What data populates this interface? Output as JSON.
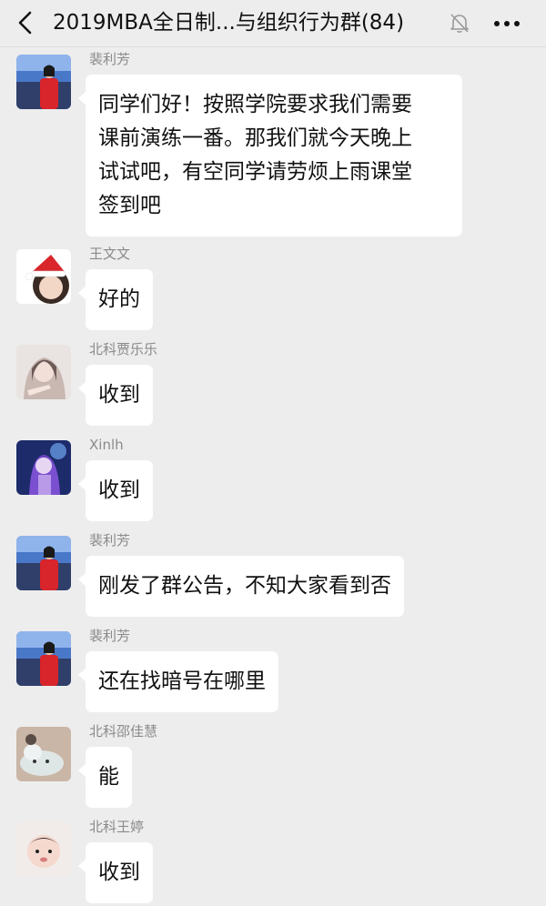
{
  "header": {
    "title": "2019MBA全日制...与组织行为群(84)",
    "back_icon": "chevron-left-icon",
    "mute_icon": "bell-off-icon",
    "more_icon": "more-horizontal-icon"
  },
  "messages": [
    {
      "sender": "裴利芳",
      "avatar": "avatar-woman-red-jacket",
      "lines": [
        "同学们好！按照学院要求我们需要",
        "课前演练一番。那我们就今天晚上",
        "试试吧，有空同学请劳烦上雨课堂",
        "签到吧"
      ]
    },
    {
      "sender": "王文文",
      "avatar": "avatar-girl-santa-hat",
      "lines": [
        "好的"
      ]
    },
    {
      "sender": "北科贾乐乐",
      "avatar": "avatar-girl-portrait",
      "lines": [
        "收到"
      ]
    },
    {
      "sender": "Xinlh",
      "avatar": "avatar-anime-purple",
      "lines": [
        "收到"
      ]
    },
    {
      "sender": "裴利芳",
      "avatar": "avatar-woman-red-jacket",
      "lines": [
        "刚发了群公告，不知大家看到否"
      ]
    },
    {
      "sender": "裴利芳",
      "avatar": "avatar-woman-red-jacket",
      "lines": [
        "还在找暗号在哪里"
      ]
    },
    {
      "sender": "北科邵佳慧",
      "avatar": "avatar-plush-toy",
      "lines": [
        "能"
      ]
    },
    {
      "sender": "北科王婷",
      "avatar": "avatar-baby",
      "lines": [
        "收到"
      ]
    }
  ],
  "colors": {
    "background": "#ededed",
    "bubble": "#ffffff",
    "sender_name": "#8a8a8a",
    "text": "#111111"
  }
}
